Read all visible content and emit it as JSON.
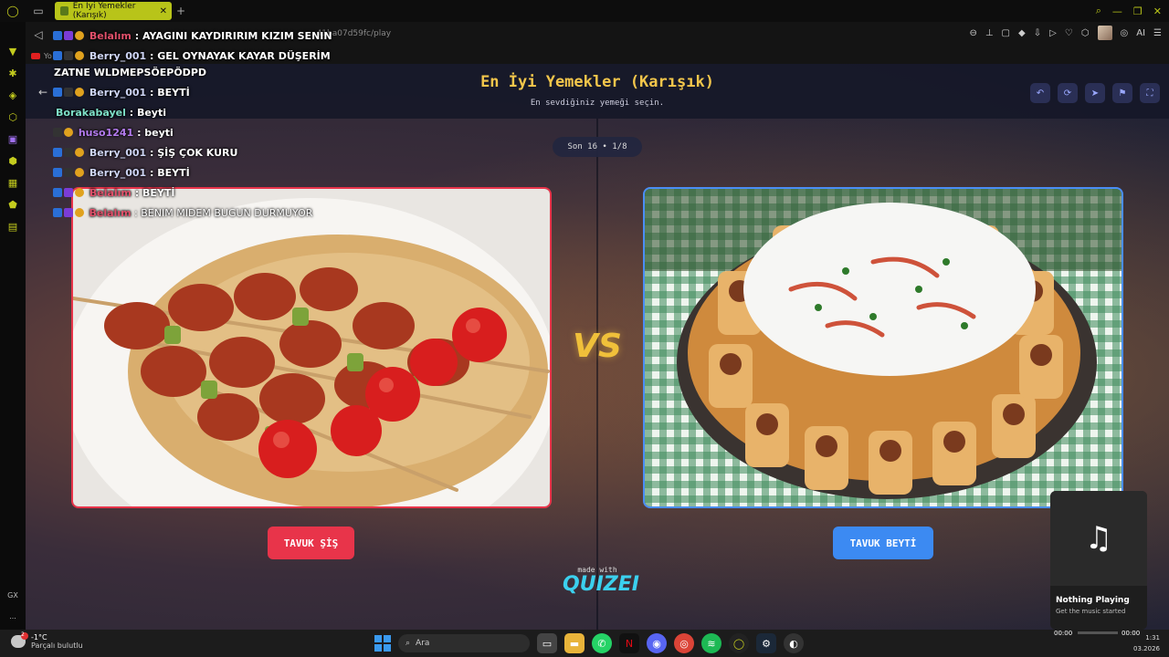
{
  "browser": {
    "tab_title": "En İyi Yemekler (Karışık)",
    "tab_close": "✕",
    "new_tab": "+",
    "address_text": "...41ba07d59fc/play",
    "bookmark_label": "Yo"
  },
  "page": {
    "title": "En İyi Yemekler (Karışık)",
    "subtitle": "En sevdiğiniz yemeği seçin.",
    "round_label": "Son 16 • 1/8",
    "vs_label": "VS",
    "left_choice": "TAVUK ŞİŞ",
    "right_choice": "TAVUK BEYTİ",
    "made_with": "made with",
    "brand": "QUIZEI"
  },
  "chat": [
    {
      "user": "Belalım",
      "user_color": "#e0506a",
      "message": "AYAGINI KAYDIRIRIM KIZIM SENIN"
    },
    {
      "user": "Berry_001",
      "user_color": "#cfd6f5",
      "message": "GEL OYNAYAK KAYAR DÜŞERİM"
    },
    {
      "user": "",
      "user_color": "#ffffff",
      "message": "ZATNE WLDMEPSÖEPÖDPD"
    },
    {
      "user": "Berry_001",
      "user_color": "#cfd6f5",
      "message": "BEYTİ"
    },
    {
      "user": "Borakabayel",
      "user_color": "#7ee0c8",
      "message": "Beyti"
    },
    {
      "user": "huso1241",
      "user_color": "#b57cf0",
      "message": "beyti"
    },
    {
      "user": "Berry_001",
      "user_color": "#cfd6f5",
      "message": "ŞİŞ ÇOK KURU"
    },
    {
      "user": "Berry_001",
      "user_color": "#cfd6f5",
      "message": "BEYTİ"
    },
    {
      "user": "Belalım",
      "user_color": "#e0506a",
      "message": "BEYTİ"
    },
    {
      "user": "Belalım",
      "user_color": "#e0506a",
      "message": "BENIM MIDEM BUGUN DURMUYOR"
    }
  ],
  "player": {
    "status": "Nothing Playing",
    "hint": "Get the music started",
    "elapsed": "00:00",
    "total": "00:00",
    "progress": 0
  },
  "taskbar": {
    "temperature": "-1°C",
    "weather": "Parçalı bulutlu",
    "search_placeholder": "Ara",
    "notification_count": "2",
    "time": "1:31",
    "date": "03.2026"
  },
  "sidebar": {
    "gx_label": "GX",
    "more_label": "..."
  },
  "colors": {
    "accent_gold": "#f3c64b",
    "left_red": "#e8344a",
    "right_blue": "#3c8af2",
    "opera_lime": "#c4cc1e"
  }
}
